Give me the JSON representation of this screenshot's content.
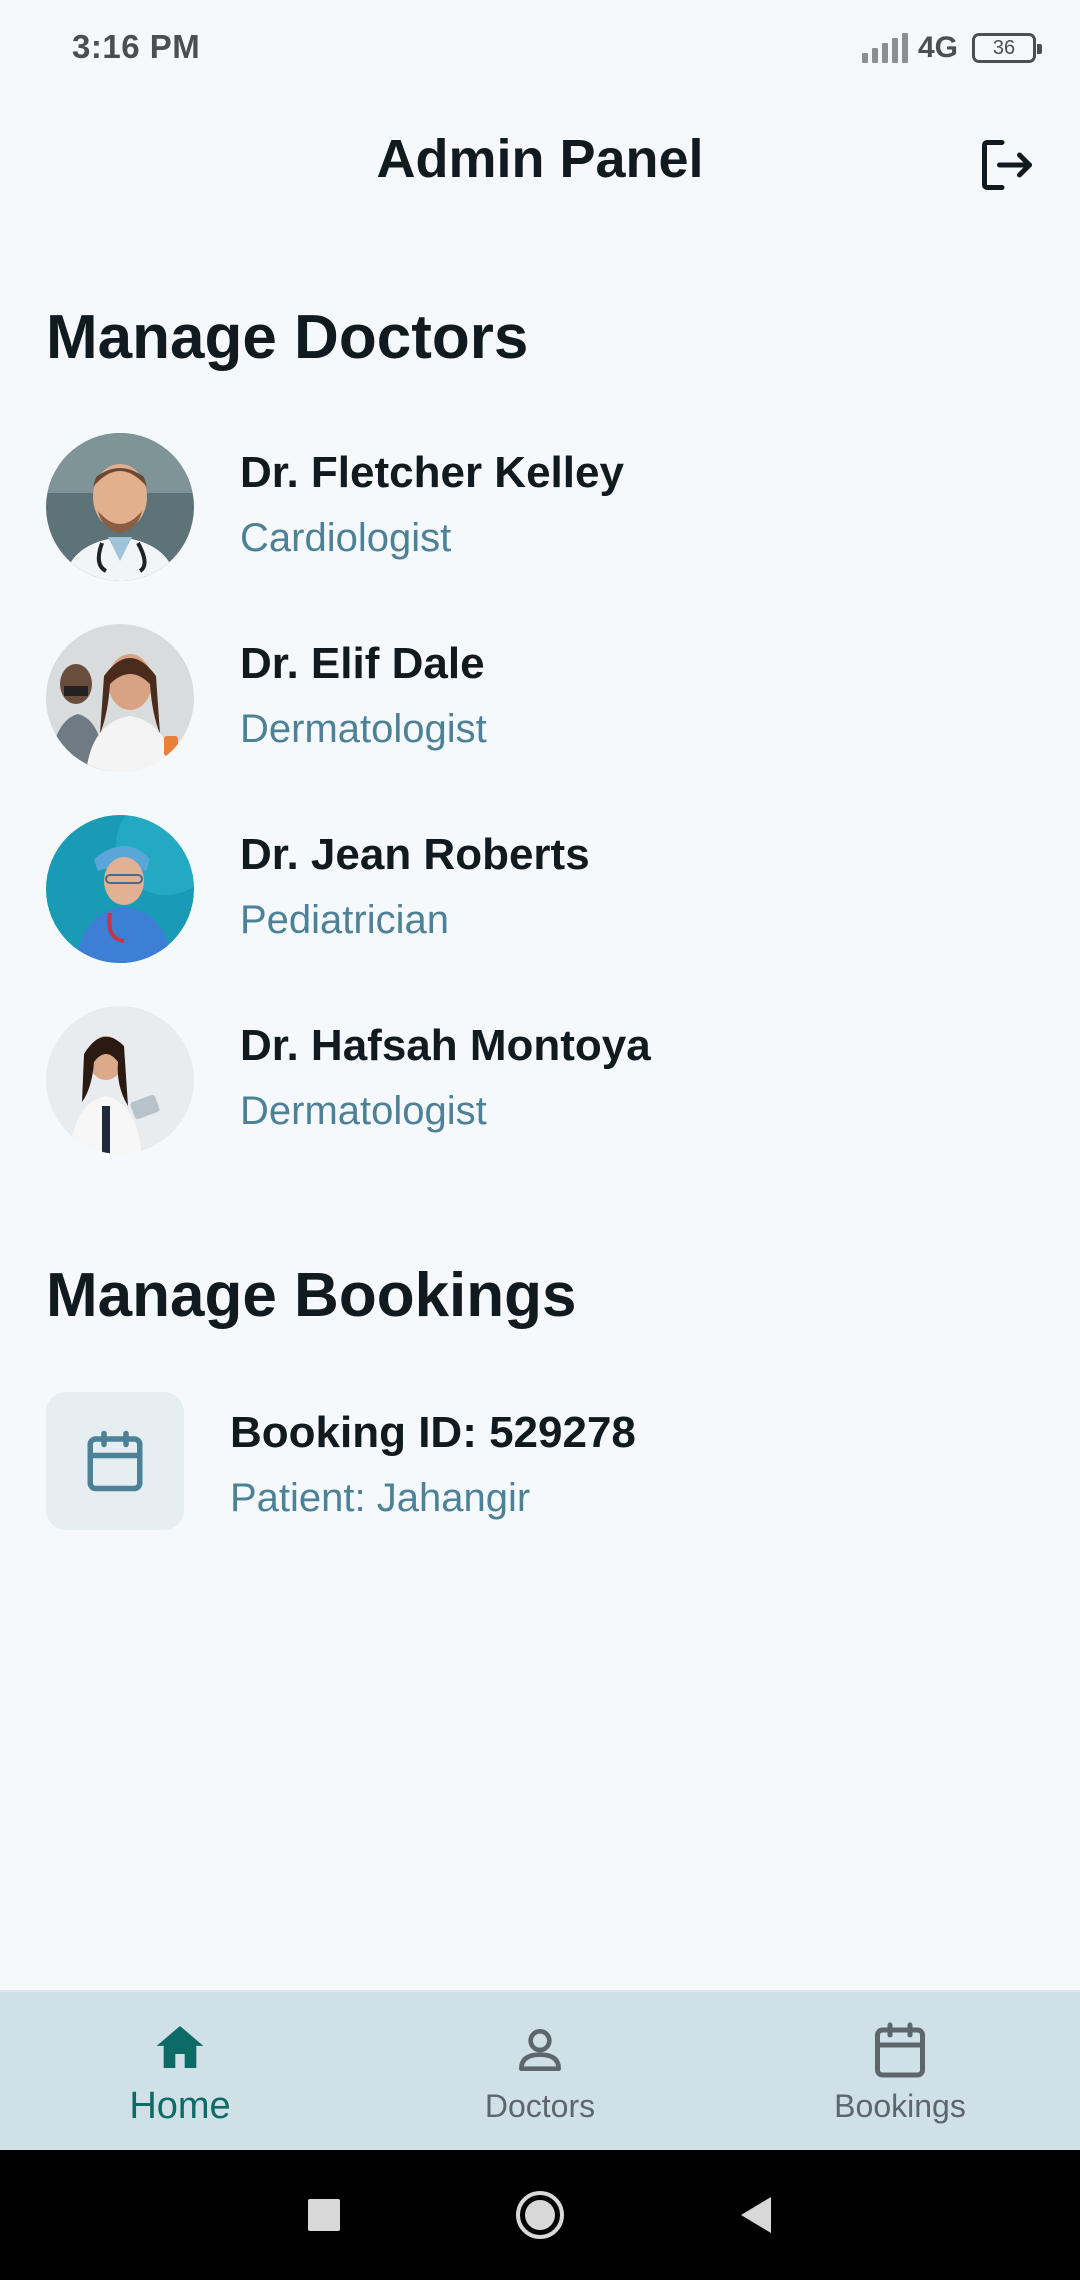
{
  "status_bar": {
    "time": "3:16 PM",
    "network": "4G",
    "battery": "36"
  },
  "app_bar": {
    "title": "Admin Panel",
    "logout_icon": "logout-icon"
  },
  "doctors_section": {
    "title": "Manage Doctors",
    "doctors": [
      {
        "name": "Dr. Fletcher Kelley",
        "specialty": "Cardiologist"
      },
      {
        "name": "Dr. Elif Dale",
        "specialty": "Dermatologist"
      },
      {
        "name": "Dr. Jean Roberts",
        "specialty": "Pediatrician"
      },
      {
        "name": "Dr. Hafsah Montoya",
        "specialty": "Dermatologist"
      }
    ]
  },
  "bookings_section": {
    "title": "Manage Bookings",
    "bookings": [
      {
        "id_label": "Booking ID: 529278",
        "patient_label": "Patient: Jahangir",
        "icon": "calendar-icon"
      }
    ]
  },
  "bottom_nav": {
    "items": [
      {
        "label": "Home",
        "icon": "home-icon",
        "active": true
      },
      {
        "label": "Doctors",
        "icon": "person-icon",
        "active": false
      },
      {
        "label": "Bookings",
        "icon": "calendar-icon",
        "active": false
      }
    ]
  },
  "colors": {
    "background": "#f6f9fb",
    "accent_teal": "#0d6b66",
    "secondary_text": "#4c8197",
    "nav_background": "#cfe1e7"
  }
}
